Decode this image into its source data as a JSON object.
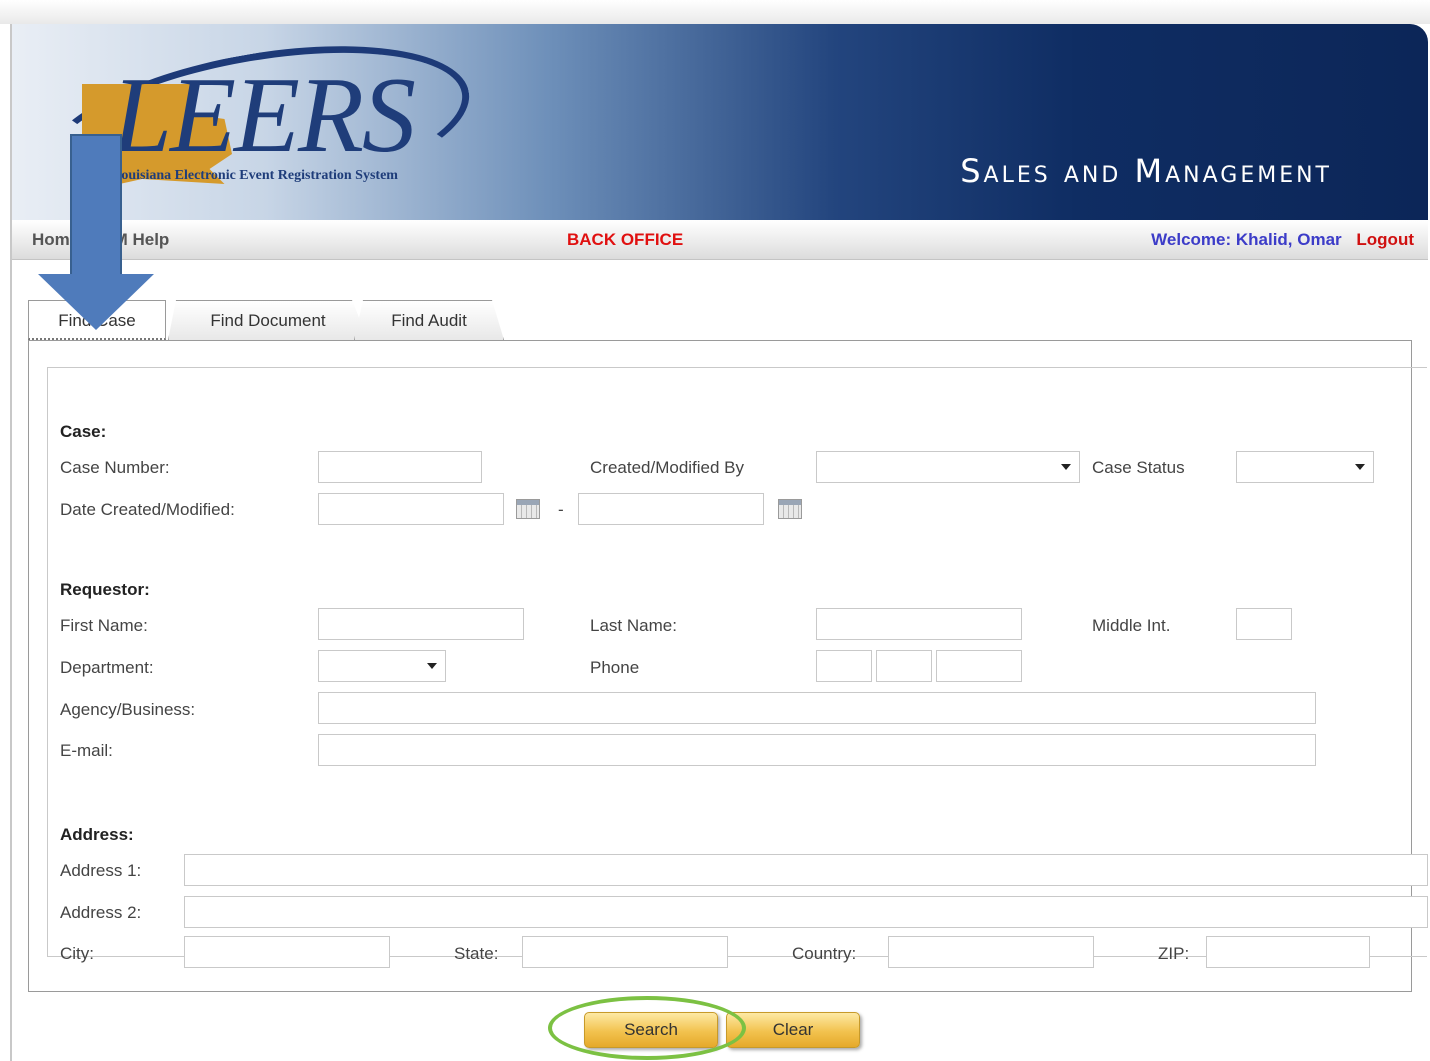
{
  "header": {
    "logo_text": "LEERS",
    "logo_subtitle": "Louisiana Electronic Event Registration System",
    "system_title": "Sales and Management"
  },
  "nav": {
    "home": "Home",
    "sam_help": "SAM Help",
    "section": "BACK OFFICE",
    "welcome": "Welcome: Khalid, Omar",
    "logout": "Logout"
  },
  "tabs": [
    {
      "label": "Find Case",
      "active": true
    },
    {
      "label": "Find Document",
      "active": false
    },
    {
      "label": "Find Audit",
      "active": false
    }
  ],
  "case": {
    "heading": "Case:",
    "case_number": "Case Number:",
    "created_modified_by": "Created/Modified By",
    "case_status": "Case Status",
    "date_created_modified": "Date Created/Modified:",
    "date_separator": "-"
  },
  "requestor": {
    "heading": "Requestor:",
    "first_name": "First Name:",
    "last_name": "Last Name:",
    "middle_int": "Middle Int.",
    "department": "Department:",
    "phone": "Phone",
    "agency": "Agency/Business:",
    "email": "E-mail:"
  },
  "address": {
    "heading": "Address:",
    "address1": "Address 1:",
    "address2": "Address 2:",
    "city": "City:",
    "state": "State:",
    "country": "Country:",
    "zip": "ZIP:"
  },
  "buttons": {
    "search": "Search",
    "clear": "Clear"
  },
  "colors": {
    "nav_section": "#e01010",
    "welcome": "#3c3cc8",
    "button_gold": "#f2c24e",
    "highlight_green": "#7cc143",
    "annotation_arrow": "#4f7bbb"
  }
}
